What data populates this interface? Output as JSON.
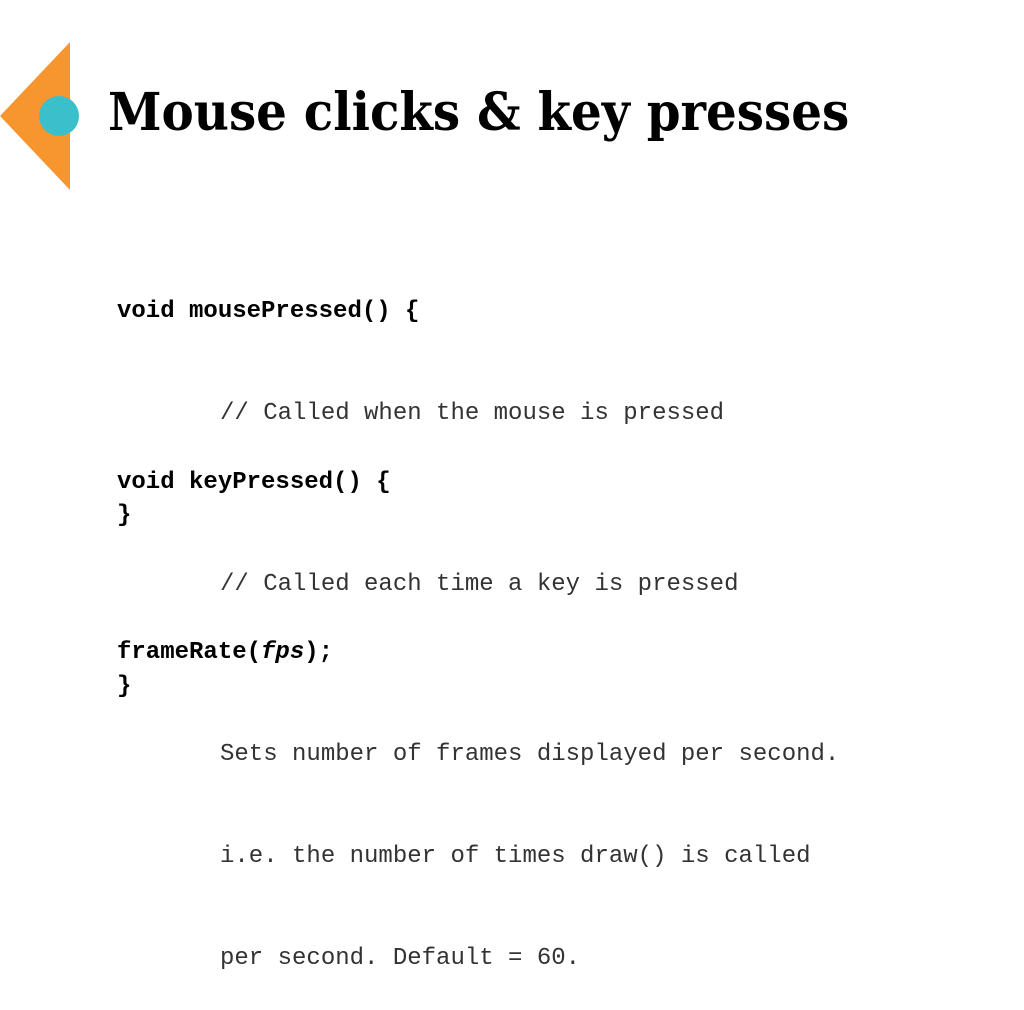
{
  "slide": {
    "title": "Mouse clicks & key presses",
    "colors": {
      "triangle": "#f7962f",
      "circle": "#3bbfcb"
    },
    "blocks": [
      {
        "signature": "void mousePressed() {",
        "body": [
          "// Called when the mouse is pressed"
        ],
        "closing": "}"
      },
      {
        "signature": "void keyPressed() {",
        "body": [
          "// Called each time a key is pressed"
        ],
        "closing": "}"
      },
      {
        "signature_prefix": "frameRate(",
        "signature_param": "fps",
        "signature_suffix": ");",
        "body": [
          "Sets number of frames displayed per second.",
          "i.e. the number of times draw() is called",
          "per second. Default = 60."
        ]
      }
    ]
  }
}
